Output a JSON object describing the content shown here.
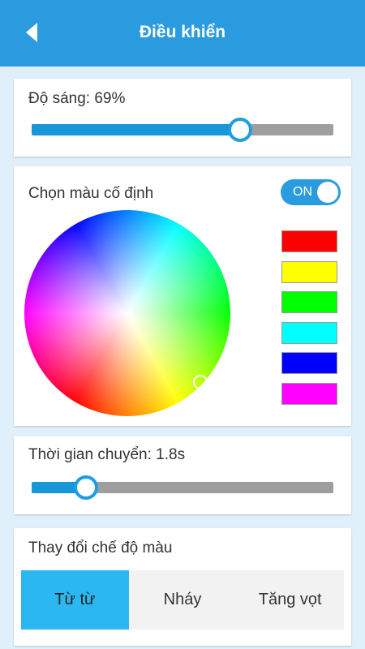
{
  "header": {
    "title": "Điều khiển",
    "back_icon": "back-arrow-icon"
  },
  "brightness": {
    "label": "Độ sáng: 69%",
    "value_fraction": 0.69
  },
  "fixed_color": {
    "label": "Chọn màu cố định",
    "toggle_label": "ON",
    "toggle_on": true,
    "swatches": [
      "#ff0000",
      "#ffff00",
      "#00ff00",
      "#00ffff",
      "#0000ff",
      "#ff00ff"
    ]
  },
  "transition": {
    "label": "Thời gian chuyển: 1.8s",
    "value_fraction": 0.18
  },
  "mode": {
    "label": "Thay đổi chế độ màu",
    "options": [
      "Từ từ",
      "Nháy",
      "Tăng vọt"
    ],
    "selected": "Từ từ"
  },
  "colors": {
    "primary": "#2b9be0",
    "background": "#e0f0fb",
    "slider_fill": "#1797d8",
    "slider_track": "#9e9e9e",
    "mode_active": "#2bb8f2"
  }
}
